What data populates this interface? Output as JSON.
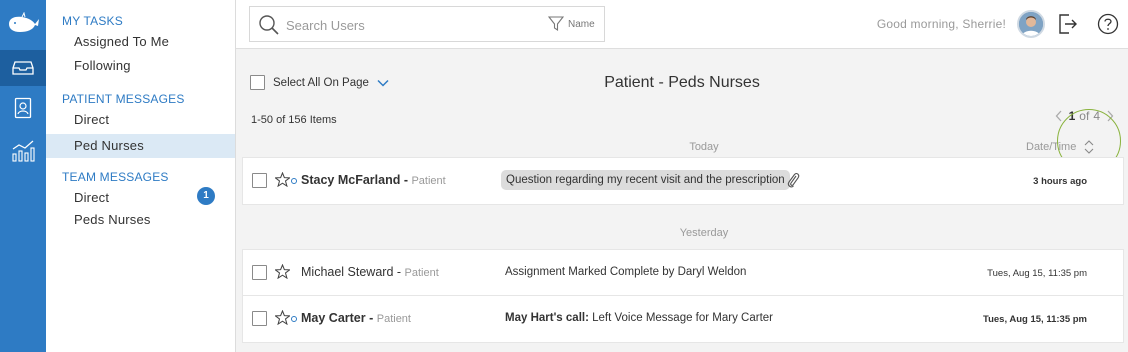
{
  "nav": {
    "my_tasks_header": "MY TASKS",
    "assigned_to_me": "Assigned To Me",
    "following": "Following",
    "patient_messages_header": "PATIENT MESSAGES",
    "patient_direct": "Direct",
    "ped_nurses": "Ped Nurses",
    "team_messages_header": "TEAM MESSAGES",
    "team_direct": "Direct",
    "team_direct_badge": "1",
    "peds_nurses": "Peds Nurses"
  },
  "header": {
    "search_placeholder": "Search Users",
    "filter_label": "Name",
    "greeting": "Good morning, Sherrie!"
  },
  "main": {
    "select_all": "Select All On Page",
    "title": "Patient - Peds Nurses",
    "count": "1-50 of 156 Items",
    "pager": {
      "current": "1",
      "of": "of",
      "total": "4"
    },
    "datetime_label": "Date/Time",
    "groups": [
      {
        "label": "Today",
        "rows": [
          {
            "name": "Stacy McFarland",
            "role": "Patient",
            "message_bold": "",
            "message": "Question regarding my recent visit and the prescription",
            "time": "3 hours ago"
          }
        ]
      },
      {
        "label": "Yesterday",
        "rows": [
          {
            "name": "Michael Steward",
            "role": "Patient",
            "message_bold": "",
            "message": "Assignment Marked Complete by Daryl Weldon",
            "time": "Tues, Aug 15, 11:35 pm"
          },
          {
            "name": "May Carter",
            "role": "Patient",
            "message_bold": "May Hart's call:",
            "message": "Left Voice Message for Mary Carter",
            "time": "Tues, Aug 15, 11:35 pm"
          }
        ]
      }
    ]
  },
  "colors": {
    "accent": "#2e7bc4",
    "nav_selected": "#dbe9f5",
    "highlight_ring": "#8ab33e"
  },
  "icons": [
    "whale-logo-icon",
    "inbox-icon",
    "contact-card-icon",
    "analytics-icon",
    "search-icon",
    "filter-icon",
    "logout-icon",
    "help-icon",
    "star-icon",
    "paperclip-icon",
    "sort-icon",
    "chevron-left-icon",
    "chevron-right-icon",
    "chevron-down-icon"
  ]
}
